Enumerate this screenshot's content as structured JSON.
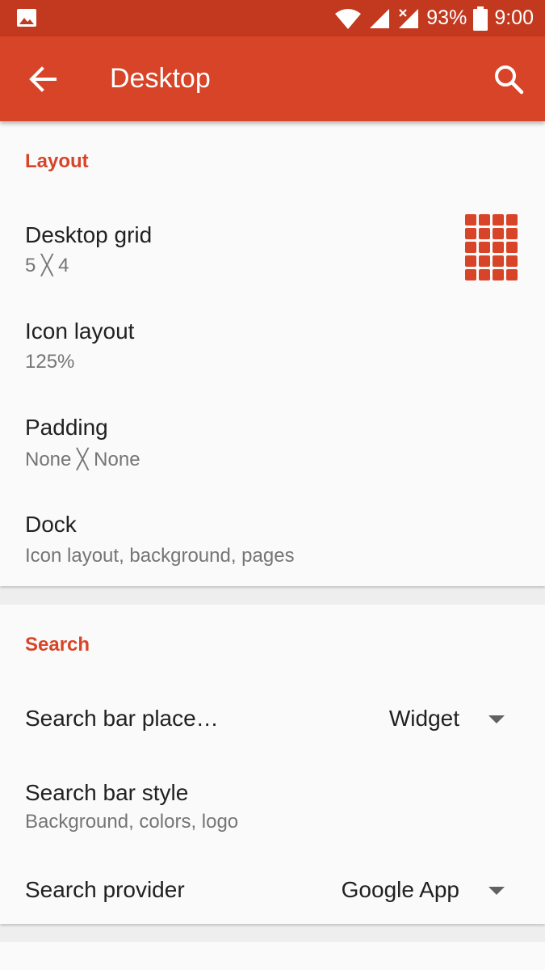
{
  "status_bar": {
    "battery": "93%",
    "time": "9:00",
    "icons": [
      "gallery-icon",
      "wifi-icon",
      "signal-icon",
      "signal-off-icon",
      "battery-icon"
    ]
  },
  "app_bar": {
    "title": "Desktop",
    "back_icon": "arrow-back-icon",
    "search_icon": "search-icon",
    "color": "#d84427"
  },
  "layout_section": {
    "header": "Layout",
    "items": [
      {
        "title": "Desktop grid",
        "summary": "5 ╳ 4",
        "icon": "grid-icon"
      },
      {
        "title": "Icon layout",
        "summary": "125%"
      },
      {
        "title": "Padding",
        "summary": "None ╳ None"
      },
      {
        "title": "Dock",
        "summary": "Icon layout, background, pages"
      }
    ]
  },
  "search_section": {
    "header": "Search",
    "items": [
      {
        "title": "Search bar place…",
        "value": "Widget"
      },
      {
        "title": "Search bar style",
        "summary": "Background, colors, logo"
      },
      {
        "title": "Search provider",
        "value": "Google App"
      }
    ]
  },
  "colors": {
    "accent": "#d84427",
    "status_bar": "#c2391f",
    "background": "#fafafa"
  }
}
